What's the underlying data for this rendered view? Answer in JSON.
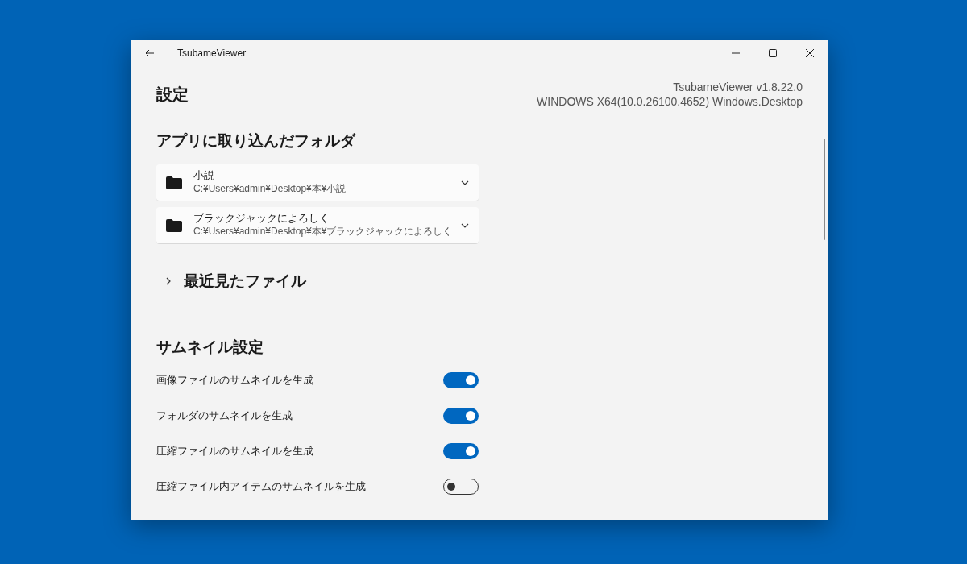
{
  "window": {
    "title": "TsubameViewer"
  },
  "page_title": "設定",
  "version_info": [
    "TsubameViewer v1.8.22.0",
    "WINDOWS X64(10.0.26100.4652) Windows.Desktop"
  ],
  "imported_folders": {
    "heading": "アプリに取り込んだフォルダ",
    "items": [
      {
        "name": "小説",
        "path": "C:¥Users¥admin¥Desktop¥本¥小説",
        "expanded": false
      },
      {
        "name": "ブラックジャックによろしく",
        "path": "C:¥Users¥admin¥Desktop¥本¥ブラックジャックによろしく",
        "expanded": false
      }
    ]
  },
  "recent_files": {
    "heading": "最近見たファイル",
    "expanded": false
  },
  "thumbnail_settings": {
    "heading": "サムネイル設定",
    "items": [
      {
        "label": "画像ファイルのサムネイルを生成",
        "on": true
      },
      {
        "label": "フォルダのサムネイルを生成",
        "on": true
      },
      {
        "label": "圧縮ファイルのサムネイルを生成",
        "on": true
      },
      {
        "label": "圧縮ファイル内アイテムのサムネイルを生成",
        "on": false
      }
    ]
  }
}
